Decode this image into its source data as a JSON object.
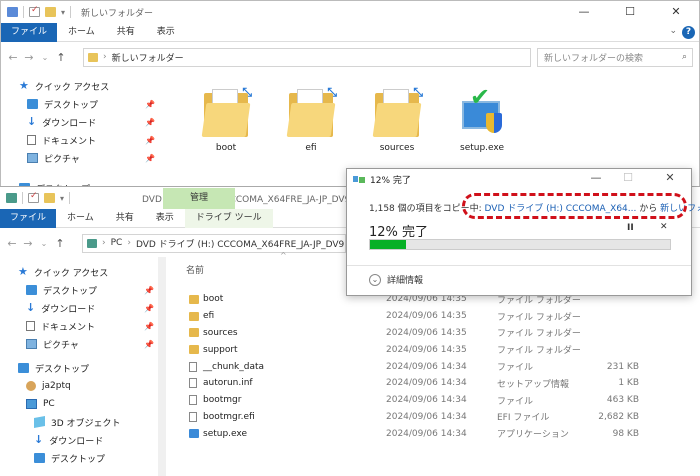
{
  "w1": {
    "title": "新しいフォルダー",
    "tabs": [
      "ファイル",
      "ホーム",
      "共有",
      "表示"
    ],
    "address": "新しいフォルダー",
    "search_placeholder": "新しいフォルダーの検索",
    "nav": [
      {
        "label": "クイック アクセス",
        "icon": "star-icon"
      },
      {
        "label": "デスクトップ",
        "icon": "desktop-icon",
        "pinned": true
      },
      {
        "label": "ダウンロード",
        "icon": "download-icon",
        "pinned": true
      },
      {
        "label": "ドキュメント",
        "icon": "document-icon",
        "pinned": true
      },
      {
        "label": "ピクチャ",
        "icon": "picture-icon",
        "pinned": true
      },
      {
        "label": "デスクトップ",
        "icon": "desktop-icon"
      }
    ],
    "items": [
      {
        "name": "boot",
        "kind": "folder"
      },
      {
        "name": "efi",
        "kind": "folder"
      },
      {
        "name": "sources",
        "kind": "folder"
      },
      {
        "name": "setup.exe",
        "kind": "setup"
      }
    ]
  },
  "w2": {
    "title": "DVD ドライブ (H:) CCCOMA_X64FRE_JA-JP_DV9",
    "context_tab": "管理",
    "tabs": [
      "ファイル",
      "ホーム",
      "共有",
      "表示",
      "ドライブ ツール"
    ],
    "address_parts": [
      "PC",
      "DVD ドライブ (H:) CCCOMA_X64FRE_JA-JP_DV9"
    ],
    "column_name": "名前",
    "nav": [
      {
        "label": "クイック アクセス",
        "icon": "star-icon",
        "indent": 1
      },
      {
        "label": "デスクトップ",
        "icon": "desktop-icon",
        "pinned": true,
        "indent": 2
      },
      {
        "label": "ダウンロード",
        "icon": "download-icon",
        "pinned": true,
        "indent": 2
      },
      {
        "label": "ドキュメント",
        "icon": "document-icon",
        "pinned": true,
        "indent": 2
      },
      {
        "label": "ピクチャ",
        "icon": "picture-icon",
        "pinned": true,
        "indent": 2
      },
      {
        "label": "デスクトップ",
        "icon": "desktop-icon",
        "indent": 1
      },
      {
        "label": "ja2ptq",
        "icon": "user-icon",
        "indent": 2
      },
      {
        "label": "PC",
        "icon": "pc-icon",
        "indent": 2
      },
      {
        "label": "3D オブジェクト",
        "icon": "3d-object-icon",
        "indent": 3
      },
      {
        "label": "ダウンロード",
        "icon": "download-icon",
        "indent": 3
      },
      {
        "label": "デスクトップ",
        "icon": "desktop-icon",
        "indent": 3
      }
    ],
    "files": [
      {
        "name": "boot",
        "date": "2024/09/06 14:35",
        "type": "ファイル フォルダー",
        "size": "",
        "kind": "folder"
      },
      {
        "name": "efi",
        "date": "2024/09/06 14:35",
        "type": "ファイル フォルダー",
        "size": "",
        "kind": "folder"
      },
      {
        "name": "sources",
        "date": "2024/09/06 14:35",
        "type": "ファイル フォルダー",
        "size": "",
        "kind": "folder"
      },
      {
        "name": "support",
        "date": "2024/09/06 14:35",
        "type": "ファイル フォルダー",
        "size": "",
        "kind": "folder"
      },
      {
        "name": "__chunk_data",
        "date": "2024/09/06 14:34",
        "type": "ファイル",
        "size": "231 KB",
        "kind": "file"
      },
      {
        "name": "autorun.inf",
        "date": "2024/09/06 14:34",
        "type": "セットアップ情報",
        "size": "1 KB",
        "kind": "file"
      },
      {
        "name": "bootmgr",
        "date": "2024/09/06 14:34",
        "type": "ファイル",
        "size": "463 KB",
        "kind": "file"
      },
      {
        "name": "bootmgr.efi",
        "date": "2024/09/06 14:34",
        "type": "EFI ファイル",
        "size": "2,682 KB",
        "kind": "file"
      },
      {
        "name": "setup.exe",
        "date": "2024/09/06 14:34",
        "type": "アプリケーション",
        "size": "98 KB",
        "kind": "setup"
      }
    ]
  },
  "dialog": {
    "title": "12% 完了",
    "line_prefix": "1,158 個の項目をコピー中: ",
    "source": "DVD ドライブ (H:) CCCOMA_X64...",
    "from_word": " から ",
    "dest": "新しいフォルダー",
    "percent_label": "12% 完了",
    "progress": 0.12,
    "details": "詳細情報",
    "pause_glyph": "II",
    "cancel_glyph": "✕"
  },
  "colors": {
    "accent": "#1a66b5",
    "progress": "#06b025",
    "highlight": "#d0101a",
    "manage_tab": "#c6e7b4"
  }
}
